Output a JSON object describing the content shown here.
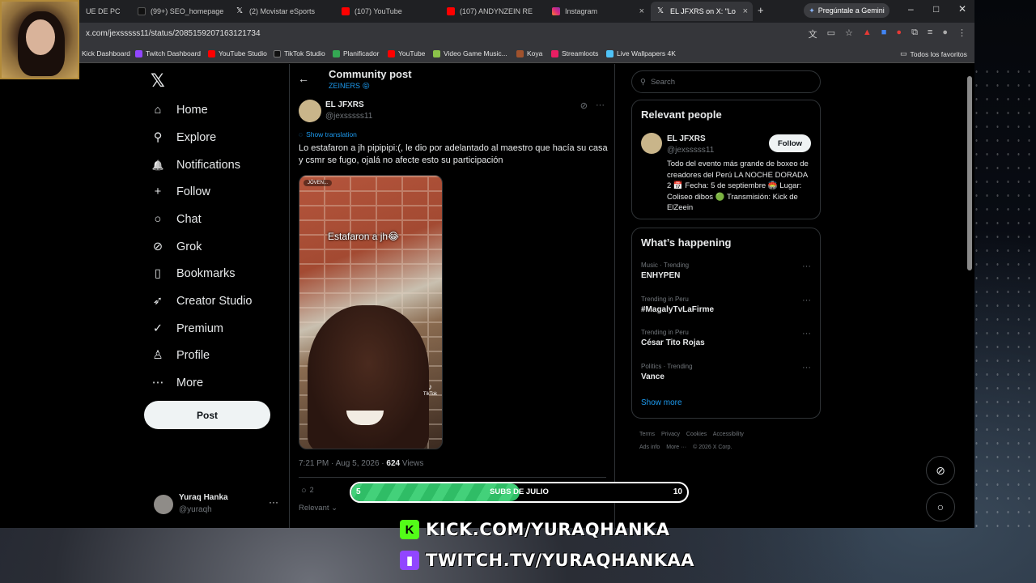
{
  "browser": {
    "tabs": [
      {
        "title": "UE DE PC",
        "color": "#444",
        "active": false
      },
      {
        "title": "(99+) SEO_homepage",
        "color": "#000",
        "active": false
      },
      {
        "title": "(2) Movistar eSports",
        "color": "#000",
        "active": false
      },
      {
        "title": "(107) YouTube",
        "color": "#ff0000",
        "active": false
      },
      {
        "title": "(107) ANDYNZEIN RE",
        "color": "#ff0000",
        "active": false
      },
      {
        "title": "Instagram",
        "color": "#e1306c",
        "active": false
      },
      {
        "title": "EL JFXRS on X: \"Lo",
        "color": "#000",
        "active": true
      }
    ],
    "new_tab": "+",
    "gemini_label": "Pregúntale a Gemini",
    "url": "x.com/jexsssss11/status/2085159207163121734",
    "bookmarks": [
      {
        "label": "Kick Dashboard",
        "color": "#53fc18"
      },
      {
        "label": "Twitch Dashboard",
        "color": "#9146ff"
      },
      {
        "label": "YouTube Studio",
        "color": "#ff0000"
      },
      {
        "label": "TikTok Studio",
        "color": "#111"
      },
      {
        "label": "Planificador",
        "color": "#34a853"
      },
      {
        "label": "YouTube",
        "color": "#ff0000"
      },
      {
        "label": "Video Game Music...",
        "color": "#8bc34a"
      },
      {
        "label": "Koya",
        "color": "#a0522d"
      },
      {
        "label": "Streamloots",
        "color": "#e91e63"
      },
      {
        "label": "Live Wallpapers 4K",
        "color": "#4fc3f7"
      }
    ],
    "all_favorites": "Todos los favoritos"
  },
  "nav": {
    "items": [
      {
        "label": "Home",
        "icon": "home-icon",
        "glyph": "⌂"
      },
      {
        "label": "Explore",
        "icon": "search-icon",
        "glyph": "⚲"
      },
      {
        "label": "Notifications",
        "icon": "bell-icon",
        "glyph": "🔔"
      },
      {
        "label": "Follow",
        "icon": "add-person-icon",
        "glyph": "+"
      },
      {
        "label": "Chat",
        "icon": "chat-icon",
        "glyph": "○"
      },
      {
        "label": "Grok",
        "icon": "grok-icon",
        "glyph": "⊘"
      },
      {
        "label": "Bookmarks",
        "icon": "bookmark-icon",
        "glyph": "▯"
      },
      {
        "label": "Creator Studio",
        "icon": "rocket-icon",
        "glyph": "➶"
      },
      {
        "label": "Premium",
        "icon": "premium-icon",
        "glyph": "✓"
      },
      {
        "label": "Profile",
        "icon": "profile-icon",
        "glyph": "♙"
      },
      {
        "label": "More",
        "icon": "more-icon",
        "glyph": "⋯"
      }
    ],
    "post_button": "Post",
    "account_name": "Yuraq Hanka",
    "account_handle": "@yuraqh"
  },
  "main": {
    "title": "Community post",
    "subtitle": "ZEINERS 😝",
    "author_name": "EL JFXRS",
    "author_handle": "@jexsssss11",
    "translate": "Show translation",
    "text": "Lo estafaron a jh pipipipi:(, le dio por adelantado al maestro que hacía su casa y csmr se fugo, ojalá no afecte esto su participación",
    "media_caption": "Estafaron a jh😂",
    "media_tag": "JÓVEN...",
    "media_watermark": "TikTok",
    "time": "7:21 PM · Aug 5, 2026 ·",
    "views_count": "624",
    "views_label": "Views",
    "replies": "2",
    "sort": "Relevant"
  },
  "sidebar": {
    "search_placeholder": "Search",
    "relevant_title": "Relevant people",
    "rp_name": "EL JFXRS",
    "rp_handle": "@jexsssss11",
    "follow": "Follow",
    "rp_bio": "Todo del evento más grande de boxeo de creadores del Perú LA NOCHE DORADA 2 📅 Fecha: 5 de septiembre 🏟️ Lugar: Coliseo dibos 🟢 Transmisión: Kick de ElZeein",
    "happening_title": "What’s happening",
    "trends": [
      {
        "context": "Music · Trending",
        "name": "ENHYPEN"
      },
      {
        "context": "Trending in Peru",
        "name": "#MagalyTvLaFirme"
      },
      {
        "context": "Trending in Peru",
        "name": "César Tito Rojas"
      },
      {
        "context": "Politics · Trending",
        "name": "Vance"
      }
    ],
    "show_more": "Show more",
    "footer": [
      "Terms",
      "Privacy",
      "Cookies",
      "Accessibility",
      "Ads info",
      "More ···",
      "© 2026 X Corp."
    ]
  },
  "overlay": {
    "subs_left": "5",
    "subs_label": "SUBS DE JULIO",
    "subs_right": "10",
    "subs_progress": 0.5,
    "kick_url": "KICK.COM/YURAQHANKA",
    "twitch_url": "TWITCH.TV/YURAQHANKAA"
  }
}
